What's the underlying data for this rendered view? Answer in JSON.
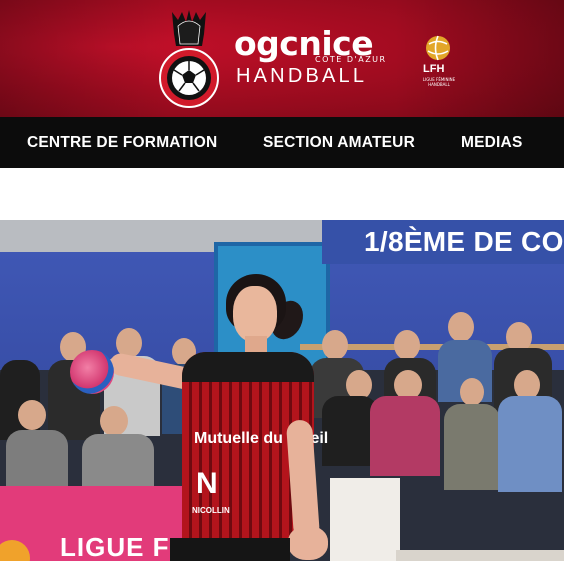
{
  "header": {
    "brand_name": "ogcnice",
    "brand_location": "COTE D'AZUR",
    "brand_sport": "HANDBALL",
    "league_short": "LFH",
    "league_full": "LIGUE FÉMININE HANDBALL",
    "colors": {
      "background": "#b3102a",
      "text": "#ffffff"
    }
  },
  "nav": {
    "items": [
      {
        "label": "CENTRE DE FORMATION"
      },
      {
        "label": "SECTION AMATEUR"
      },
      {
        "label": "MEDIAS"
      }
    ],
    "background": "#0c0c0c"
  },
  "hero": {
    "title": "1/8ÈME DE CO",
    "jersey_sponsor_main": "Mutuelle du soleil",
    "jersey_letter": "N",
    "jersey_sponsor_small": "NICOLLIN",
    "board_text": "LIGUE FE",
    "image_subject": "handball-player-photo"
  }
}
